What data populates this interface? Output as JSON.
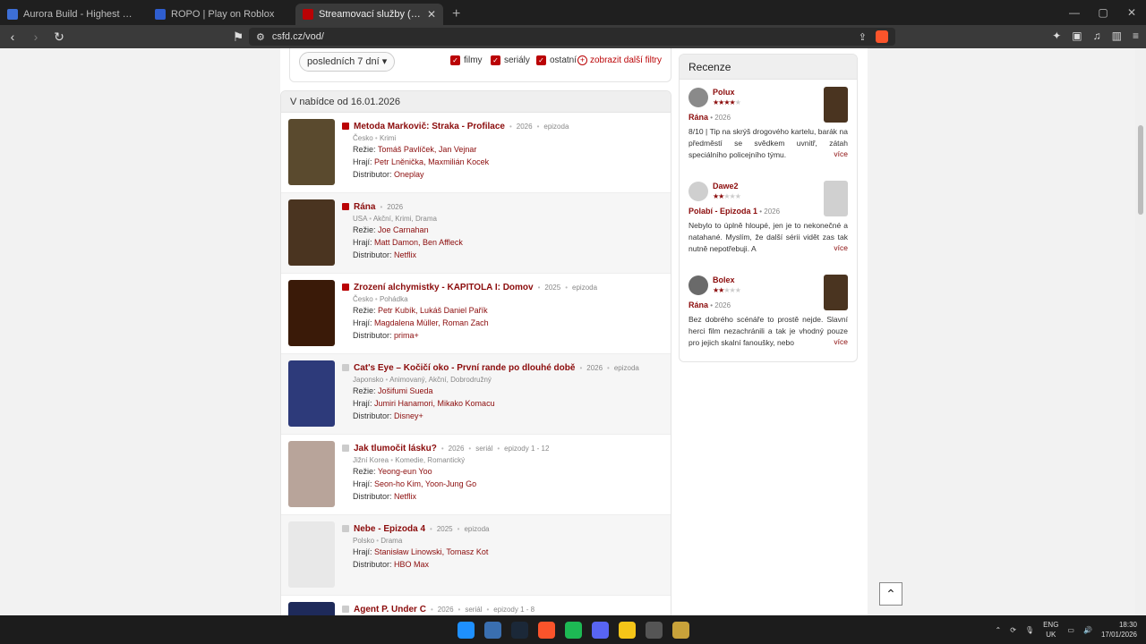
{
  "browser": {
    "tabs": [
      {
        "title": "Aurora Build - Highest Win Rate Buil",
        "color": "#3d6fd6",
        "active": false
      },
      {
        "title": "ROPO | Play on Roblox",
        "color": "#2f5ecf",
        "active": false
      },
      {
        "title": "Streamovací služby (VOD) | ČSFD",
        "color": "#ba0305",
        "active": true
      }
    ],
    "url": "csfd.cz/vod/"
  },
  "filters": {
    "period": "posledních 7 dní",
    "checks": [
      "filmy",
      "seriály",
      "ostatní"
    ],
    "more": "zobrazit další filtry"
  },
  "list": {
    "header": "V nabídce od 16.01.2026",
    "items": [
      {
        "title": "Metoda Markovič: Straka - Profilace",
        "year": "2026",
        "kind": "epizoda",
        "country": "Česko",
        "genres": "Krimi",
        "directors_label": "Režie:",
        "directors": "Tomáš Pavlíček, Jan Vejnar",
        "actors_label": "Hrají:",
        "actors": "Petr Lněnička, Maxmilián Kocek",
        "distributor_label": "Distributor:",
        "distributor": "Oneplay",
        "rated": true,
        "poster": "#5a4a2e"
      },
      {
        "title": "Rána",
        "year": "2026",
        "kind": "",
        "country": "USA",
        "genres": "Akční, Krimi, Drama",
        "directors_label": "Režie:",
        "directors": "Joe Carnahan",
        "actors_label": "Hrají:",
        "actors": "Matt Damon, Ben Affleck",
        "distributor_label": "Distributor:",
        "distributor": "Netflix",
        "rated": true,
        "poster": "#4a3420"
      },
      {
        "title": "Zrození alchymistky - KAPITOLA I: Domov",
        "year": "2025",
        "kind": "epizoda",
        "country": "Česko",
        "genres": "Pohádka",
        "directors_label": "Režie:",
        "directors": "Petr Kubík, Lukáš Daniel Pařík",
        "actors_label": "Hrají:",
        "actors": "Magdalena Müller, Roman Zach",
        "distributor_label": "Distributor:",
        "distributor": "prima+",
        "rated": true,
        "poster": "#3a1a08"
      },
      {
        "title": "Cat's Eye – Kočičí oko - První rande po dlouhé době",
        "year": "2026",
        "kind": "epizoda",
        "country": "Japonsko",
        "genres": "Animovaný, Akční, Dobrodružný",
        "directors_label": "Režie:",
        "directors": "Jošifumi Sueda",
        "actors_label": "Hrají:",
        "actors": "Jumiri Hanamori, Mikako Komacu",
        "distributor_label": "Distributor:",
        "distributor": "Disney+",
        "rated": false,
        "poster": "#2d3a7a"
      },
      {
        "title": "Jak tlumočit lásku?",
        "year": "2026",
        "kind": "seriál",
        "episodes": "epizody 1 - 12",
        "country": "Jižní Korea",
        "genres": "Komedie, Romantický",
        "directors_label": "Režie:",
        "directors": "Yeong-eun Yoo",
        "actors_label": "Hrají:",
        "actors": "Seon-ho Kim, Yoon-Jung Go",
        "distributor_label": "Distributor:",
        "distributor": "Netflix",
        "rated": false,
        "poster": "#b8a49a"
      },
      {
        "title": "Nebe - Epizoda 4",
        "year": "2025",
        "kind": "epizoda",
        "country": "Polsko",
        "genres": "Drama",
        "directors_label": "",
        "directors": "",
        "actors_label": "Hrají:",
        "actors": "Stanisław Linowski, Tomasz Kot",
        "distributor_label": "Distributor:",
        "distributor": "HBO Max",
        "rated": false,
        "poster": "#e8e8e8"
      },
      {
        "title": "Agent P. Under C",
        "year": "2026",
        "kind": "seriál",
        "episodes": "epizody 1 - 8",
        "country": "",
        "genres": "",
        "directors_label": "",
        "directors": "",
        "actors_label": "",
        "actors": "",
        "distributor_label": "",
        "distributor": "",
        "rated": false,
        "poster": "#1e2a5a"
      }
    ]
  },
  "reviews": {
    "header": "Recenze",
    "items": [
      {
        "user": "Polux",
        "stars": 4,
        "film": "Rána",
        "year": "2026",
        "text": "8/10 | Tip na skrýš drogového kartelu, barák na předměstí se svědkem uvnitř, zátah speciálního policejního týmu.",
        "more": "více",
        "poster": "#4a3420",
        "avatar": "#8a8a8a"
      },
      {
        "user": "Dawe2",
        "stars": 2,
        "film": "Polabí - Epizoda 1",
        "year": "2026",
        "text": "Nebylo to úplně hloupé, jen je to nekonečné a natahané. Myslím, že další sérii vidět zas tak nutně nepotřebuji. A",
        "more": "více",
        "poster": "#d0d0d0",
        "avatar": "#cfcfcf"
      },
      {
        "user": "Bolex",
        "stars": 2,
        "film": "Rána",
        "year": "2026",
        "text": "Bez dobrého scénáře to prostě nejde. Slavní herci film nezachránili a tak je vhodný pouze pro jejich skalní fanoušky, nebo",
        "more": "více",
        "poster": "#4a3420",
        "avatar": "#6a6a6a"
      }
    ]
  },
  "taskbar": {
    "icons": [
      "#1e90ff",
      "#3a6fb0",
      "#1b2838",
      "#fb542b",
      "#1db954",
      "#5865f2",
      "#f5c518",
      "#555555",
      "#c8a23a"
    ],
    "lang1": "ENG",
    "lang2": "UK",
    "time": "18:30",
    "date": "17/01/2026"
  }
}
